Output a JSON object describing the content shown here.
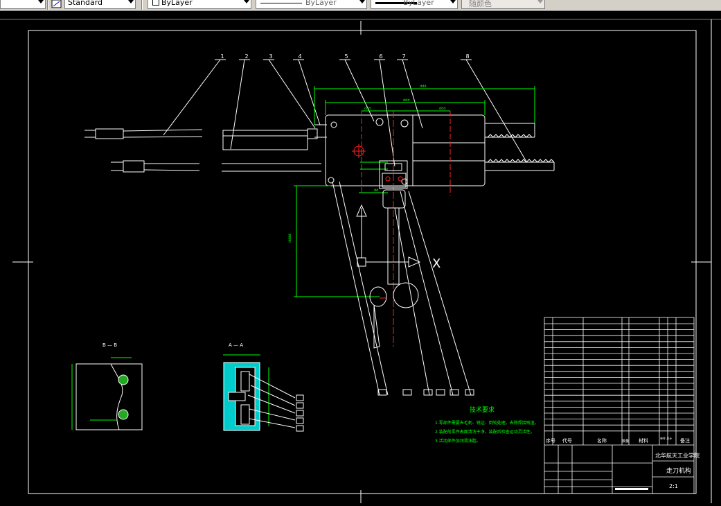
{
  "toolbar": {
    "style_value": "Standard",
    "layer_value": "ByLayer",
    "linetype_value": "ByLayer",
    "lineweight_value": "ByLayer",
    "color_value": "随颜色"
  },
  "drawing": {
    "balloons": [
      "1",
      "2",
      "3",
      "4",
      "5",
      "6",
      "7",
      "8"
    ],
    "section_bb_label": "B — B",
    "section_aa_label": "A — A",
    "axis_x_label": "X",
    "tech_req": {
      "title": "技术要求",
      "lines": [
        "1.零部件需要去毛刺、锐边、倒钝处理，去除焊接残渣。",
        "2.装配前零件表面清洗干净，装配后检查运动灵活性。",
        "3.活动部件加润滑油脂。"
      ]
    },
    "title_block": {
      "school": "北华航天工业学院",
      "drawing_name": "走刀机构",
      "scale": "2:1",
      "header_seq": "序号",
      "header_code": "代号",
      "header_name": "名称",
      "header_qty": "数量",
      "header_material": "材料",
      "header_weight": "单件 总计",
      "header_note": "备注"
    }
  }
}
